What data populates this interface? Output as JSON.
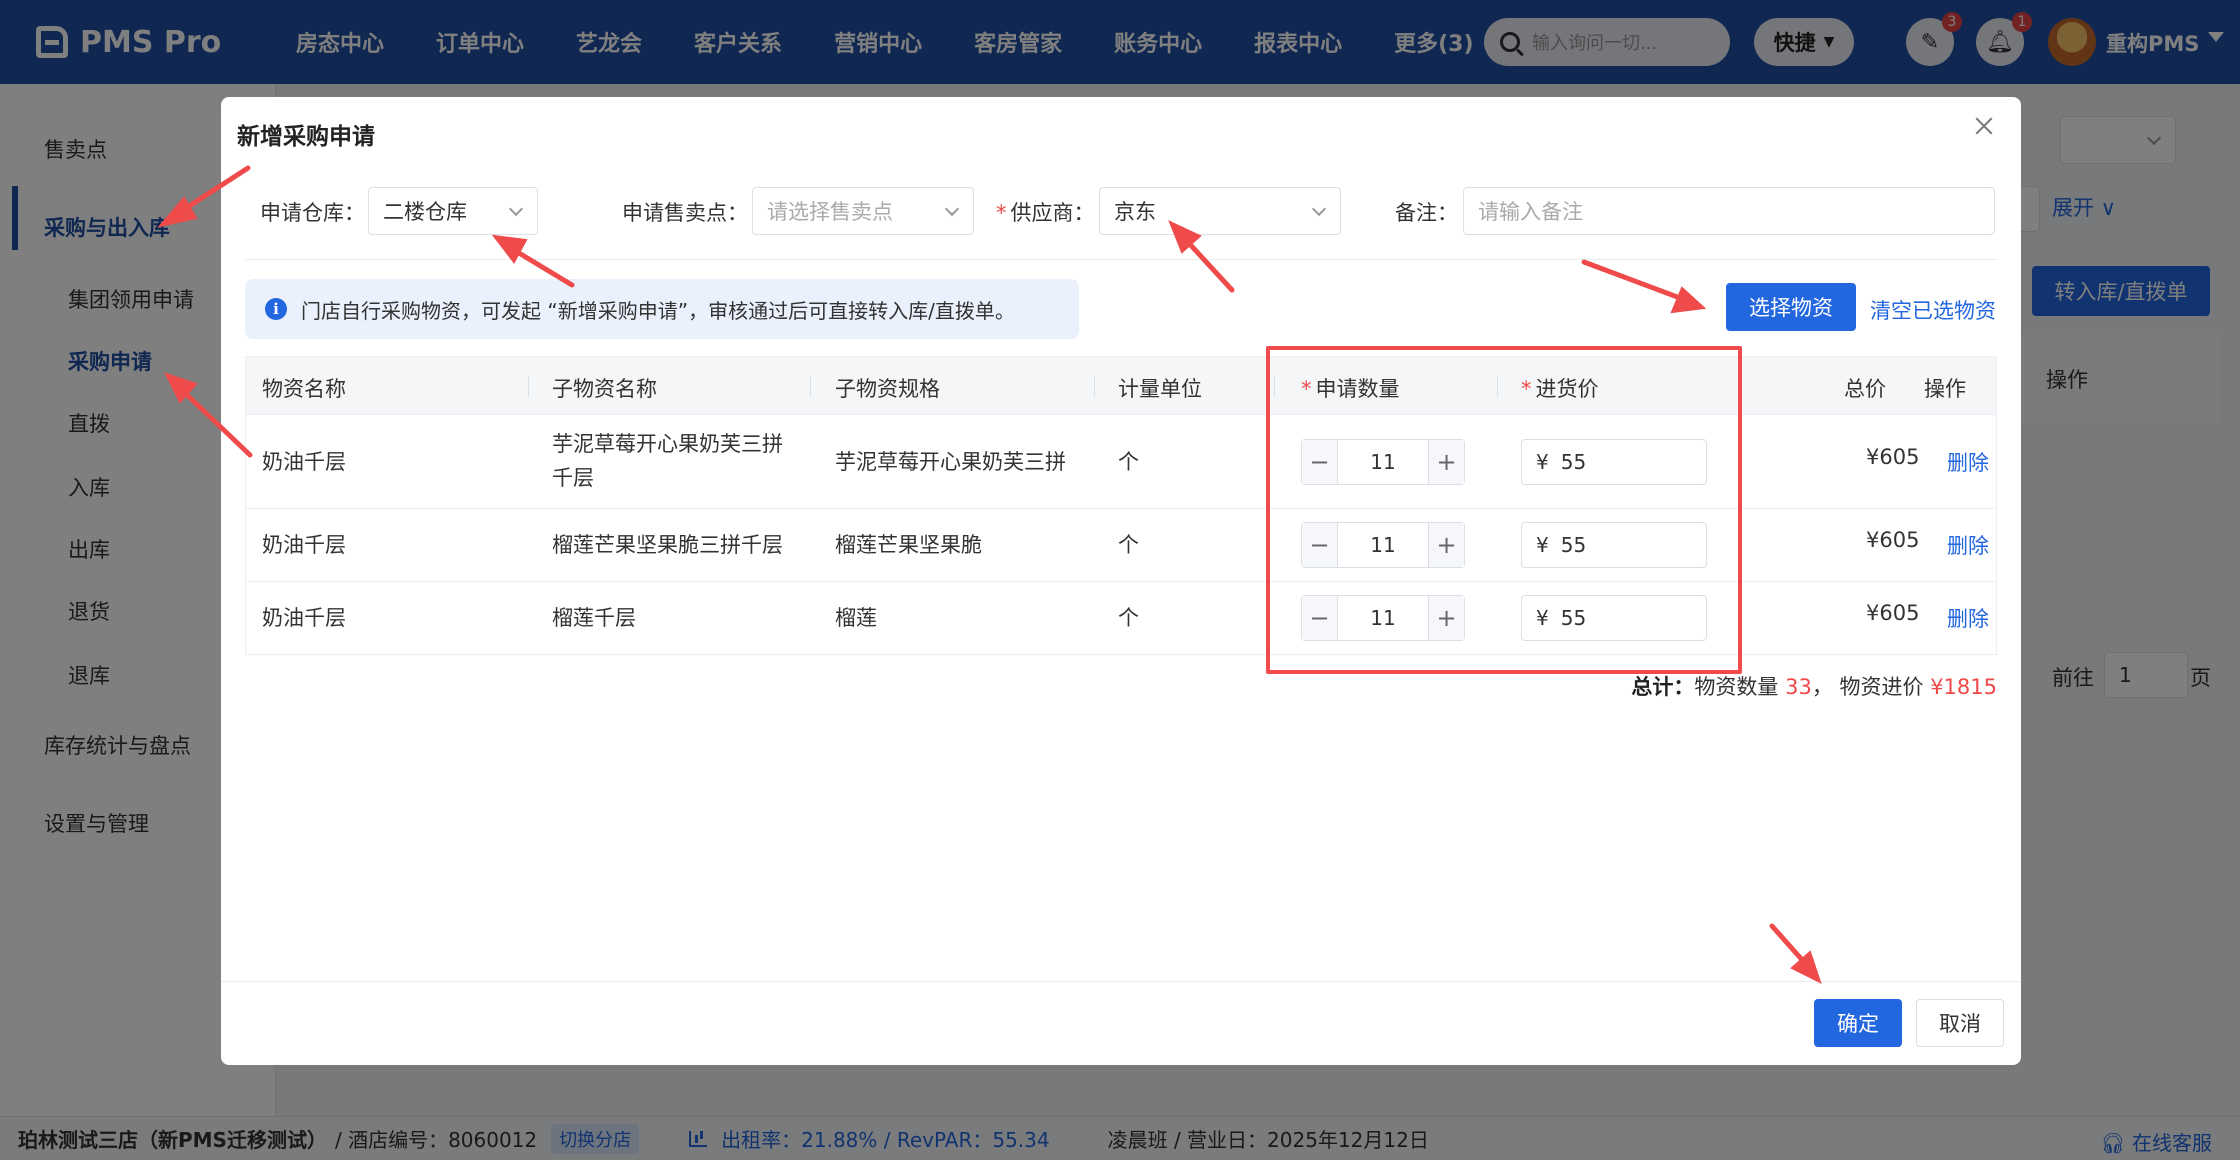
{
  "app": {
    "logo_text": "PMS Pro",
    "nav": [
      "房态中心",
      "订单中心",
      "艺龙会",
      "客户关系",
      "营销中心",
      "客房管家",
      "账务中心",
      "报表中心",
      "更多(3)"
    ],
    "search_placeholder": "输入询问一切...",
    "quick_label": "快捷",
    "notif1_count": "3",
    "notif2_count": "1",
    "user_name": "重构PMS"
  },
  "sidebar": {
    "items": [
      "售卖点",
      "采购与出入库",
      "集团领用申请",
      "采购申请",
      "直拨",
      "入库",
      "出库",
      "退货",
      "退库",
      "库存统计与盘点",
      "设置与管理"
    ]
  },
  "background": {
    "expand_label": "展开",
    "transfer_button": "转入库/直拨单",
    "op_header": "操作",
    "goto_label": "前往",
    "page_value": "1",
    "page_suffix": "页"
  },
  "footer": {
    "hotel": "珀林测试三店（新PMS迁移测试）",
    "hotel_code": "/ 酒店编号：8060012",
    "switch_label": "切换分店",
    "stats": "出租率：21.88% / RevPAR：55.34",
    "shift": "凌晨班 / 营业日：2025年12月12日",
    "service": "在线客服"
  },
  "modal": {
    "title": "新增采购申请",
    "form": {
      "warehouse_label": "申请仓库：",
      "warehouse_value": "二楼仓库",
      "sales_point_label": "申请售卖点：",
      "sales_point_placeholder": "请选择售卖点",
      "supplier_label": "供应商：",
      "supplier_value": "京东",
      "note_label": "备注：",
      "note_placeholder": "请输入备注"
    },
    "info_text": "门店自行采购物资，可发起 “新增采购申请”，审核通过后可直接转入库/直拨单。",
    "select_button": "选择物资",
    "clear_link": "清空已选物资",
    "columns": [
      "物资名称",
      "子物资名称",
      "子物资规格",
      "计量单位",
      "申请数量",
      "进货价",
      "总价",
      "操作"
    ],
    "rows": [
      {
        "name": "奶油千层",
        "sub_name": "芋泥草莓开心果奶芙三拼千层",
        "spec": "芋泥草莓开心果奶芙三拼",
        "unit": "个",
        "qty": "11",
        "currency": "¥",
        "price": "55",
        "total": "¥605",
        "action": "删除"
      },
      {
        "name": "奶油千层",
        "sub_name": "榴莲芒果坚果脆三拼千层",
        "spec": "榴莲芒果坚果脆",
        "unit": "个",
        "qty": "11",
        "currency": "¥",
        "price": "55",
        "total": "¥605",
        "action": "删除"
      },
      {
        "name": "奶油千层",
        "sub_name": "榴莲千层",
        "spec": "榴莲",
        "unit": "个",
        "qty": "11",
        "currency": "¥",
        "price": "55",
        "total": "¥605",
        "action": "删除"
      }
    ],
    "summary": {
      "label": "总计：",
      "qty_label": "物资数量",
      "qty_value": "33",
      "sep": "，",
      "price_label": "物资进价",
      "price_value": "¥1815"
    },
    "ok_button": "确定",
    "cancel_button": "取消"
  },
  "colors": {
    "primary": "#2266e0",
    "nav_bg": "#1f4fa3",
    "annotation": "#ef4b4b"
  }
}
